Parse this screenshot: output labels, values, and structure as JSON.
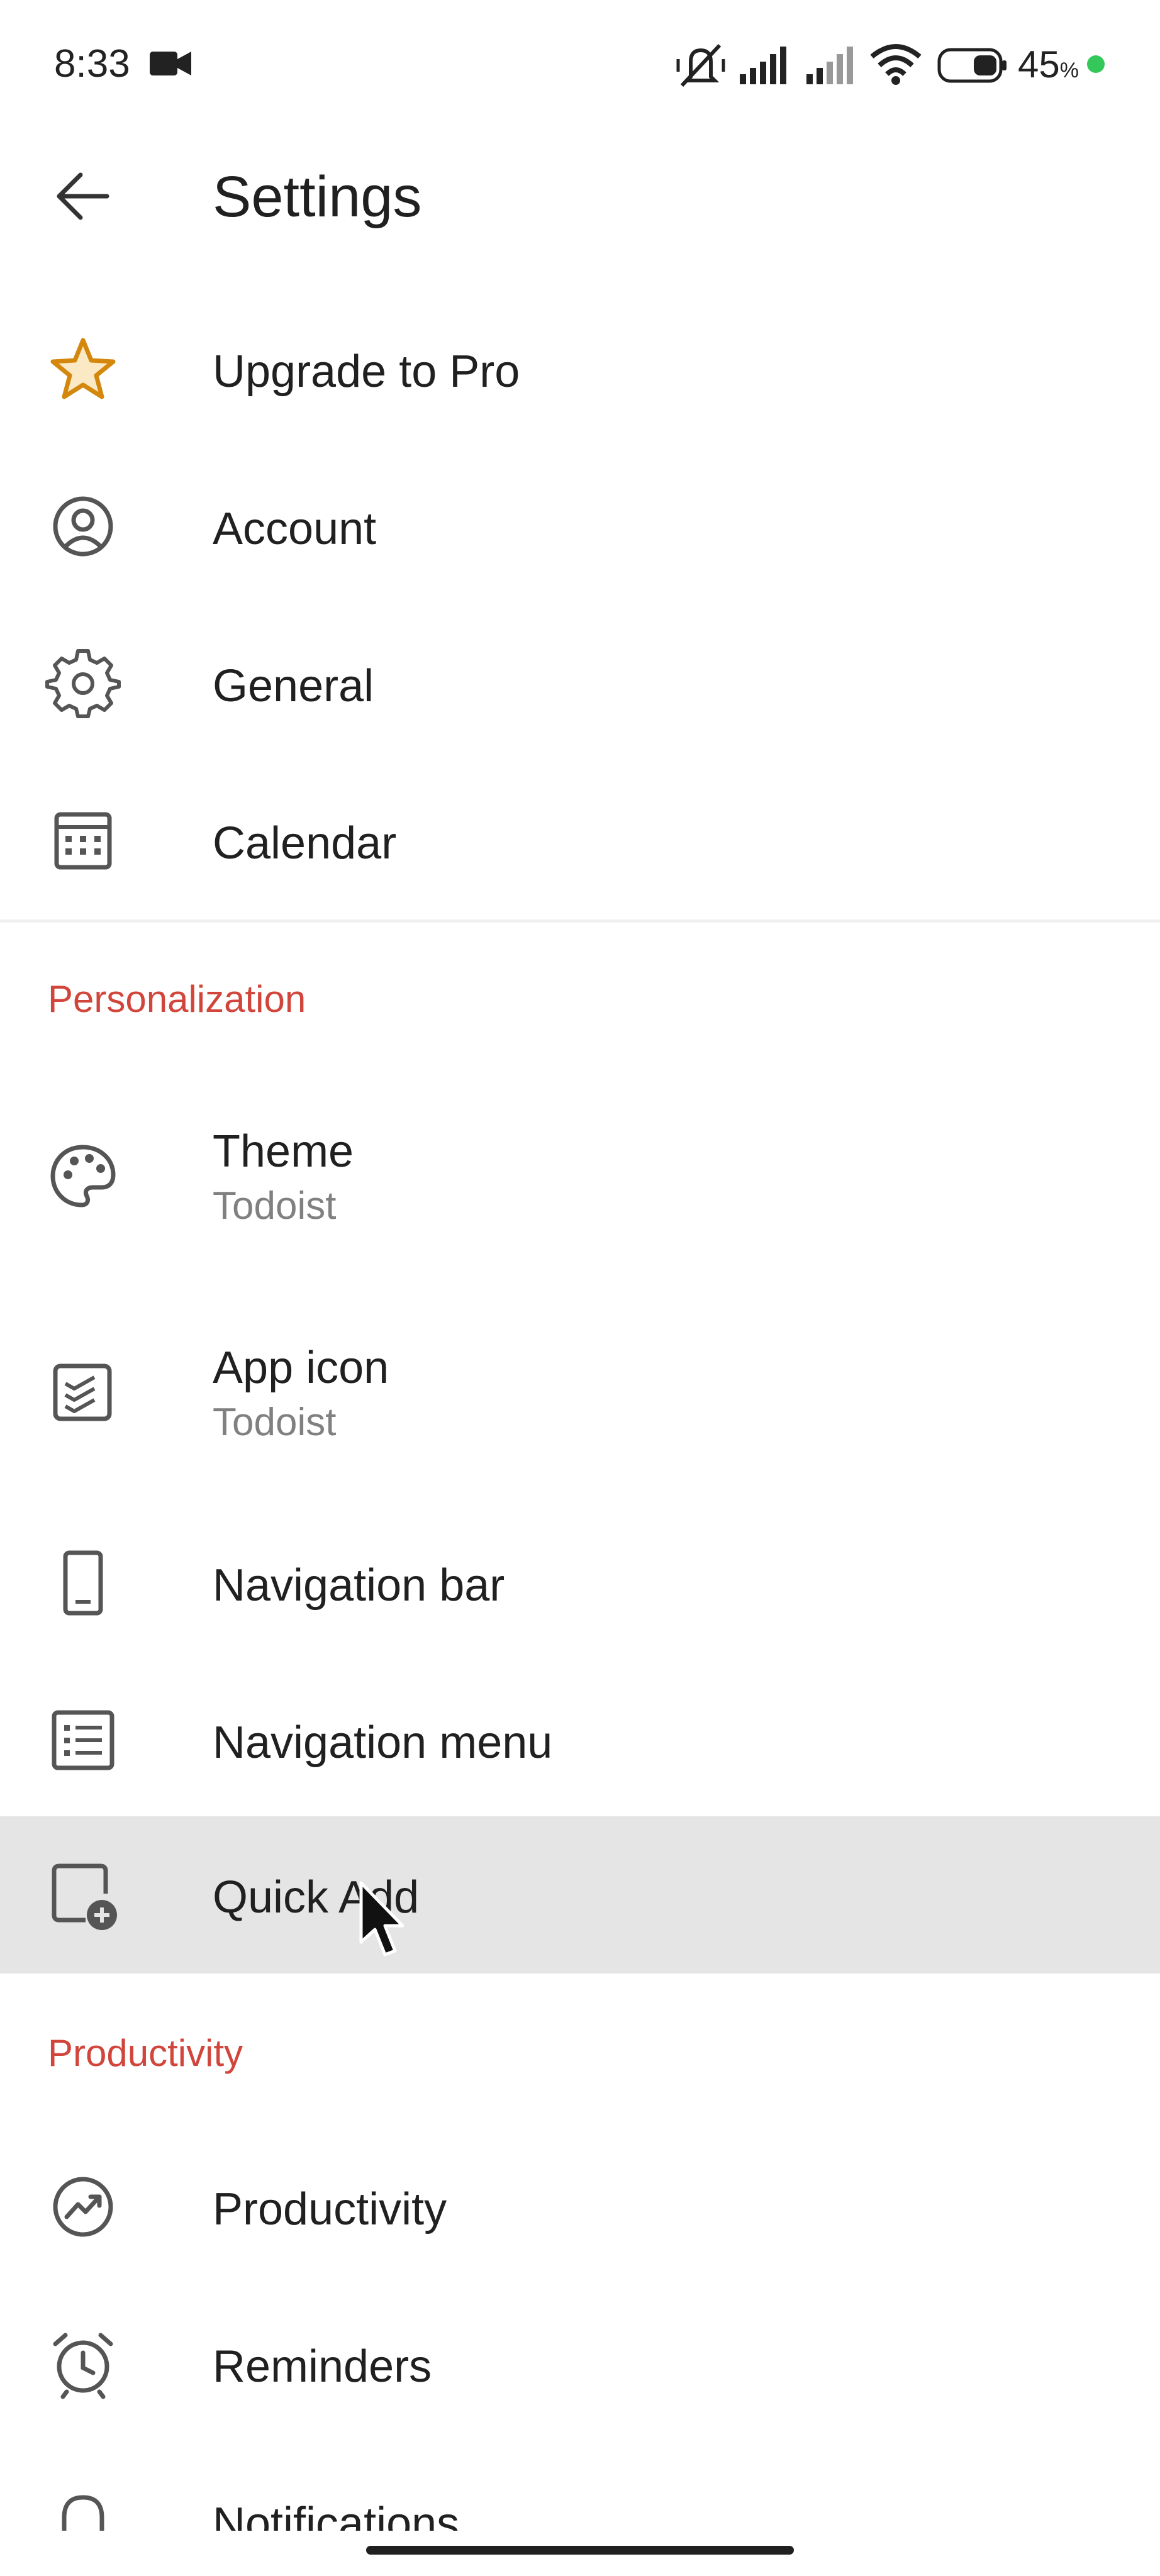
{
  "status_bar": {
    "time": "8:33",
    "battery": "45",
    "battery_unit": "%"
  },
  "header": {
    "title": "Settings"
  },
  "sections": {
    "personalization": "Personalization",
    "productivity": "Productivity"
  },
  "items": {
    "upgrade": "Upgrade to Pro",
    "account": "Account",
    "general": "General",
    "calendar": "Calendar",
    "theme": "Theme",
    "theme_value": "Todoist",
    "app_icon": "App icon",
    "app_icon_value": "Todoist",
    "navigation_bar": "Navigation bar",
    "navigation_menu": "Navigation menu",
    "quick_add": "Quick Add",
    "productivity": "Productivity",
    "reminders": "Reminders",
    "notifications": "Notifications"
  },
  "colors": {
    "accent": "#d1453b",
    "star": "#d4870d",
    "highlight": "#e5e5e5",
    "battery_dot": "#34c759"
  },
  "icons": [
    "video-icon",
    "mute-icon",
    "signal-icon",
    "wifi-icon",
    "battery-icon",
    "back-arrow-icon",
    "star-icon",
    "account-icon",
    "gear-icon",
    "calendar-icon",
    "palette-icon",
    "app-icon-icon",
    "phone-icon",
    "list-icon",
    "quick-add-icon",
    "productivity-icon",
    "alarm-icon",
    "bell-icon",
    "cursor-icon"
  ]
}
